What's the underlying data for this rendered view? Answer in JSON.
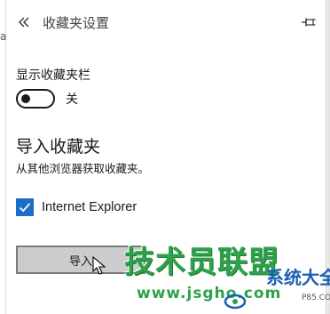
{
  "header": {
    "title": "收藏夹设置",
    "back_icon": "double-chevron-left-icon",
    "pin_icon": "pin-icon"
  },
  "left_strip_glyph": "a",
  "favorites_bar": {
    "label": "显示收藏夹栏",
    "toggle_on": false,
    "toggle_state_label": "关"
  },
  "import_section": {
    "heading": "导入收藏夹",
    "description": "从其他浏览器获取收藏夹。",
    "browsers": [
      {
        "label": "Internet Explorer",
        "checked": true
      }
    ],
    "import_button": "导入"
  },
  "watermark": {
    "title": "技术员联盟",
    "url": "www.jsgho.com",
    "site": "系统大全",
    "code": "P85.COM"
  },
  "colors": {
    "accent": "#1e6ec8",
    "button_bg": "#cccccc",
    "watermark_green": "#2ea24a"
  }
}
